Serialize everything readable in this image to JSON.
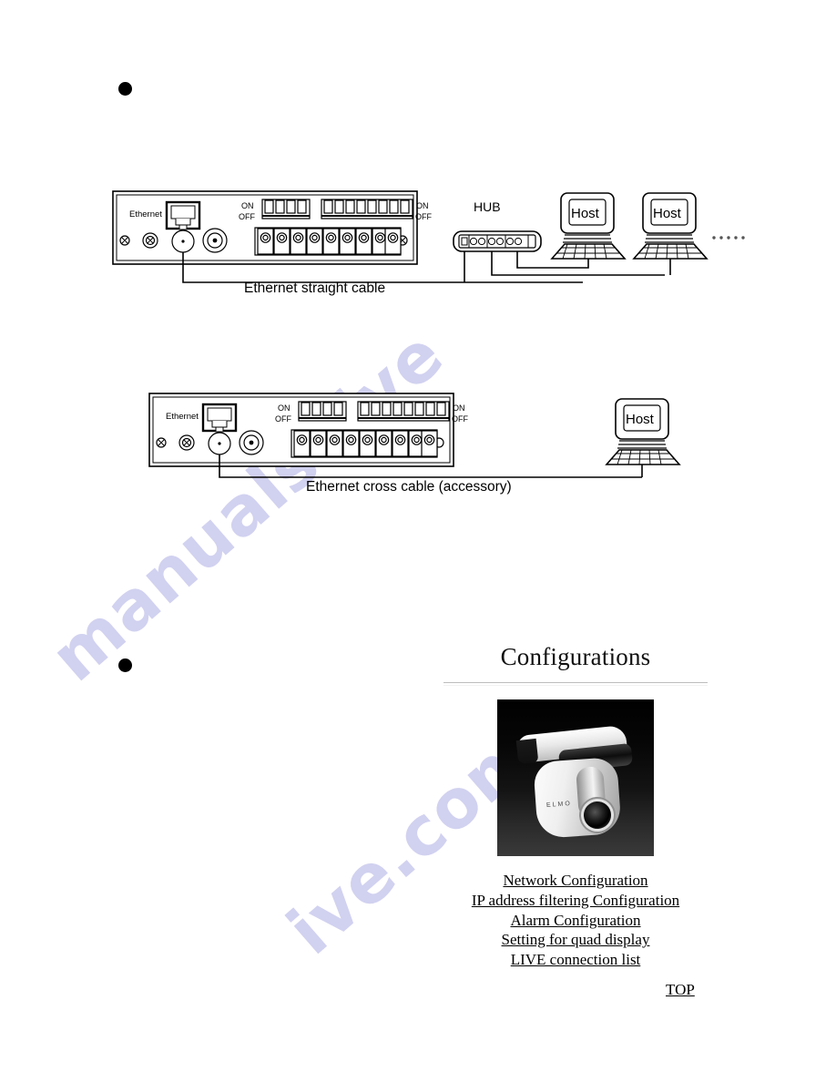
{
  "watermark": {
    "line1": "manualshive",
    "line2": "ive.com"
  },
  "bullets": [
    {
      "name": "bullet-marker-1"
    },
    {
      "name": "bullet-marker-2"
    }
  ],
  "figures": [
    {
      "id": "figure-1",
      "caption": "Ethernet straight cable",
      "device": {
        "port_label": "Ethernet",
        "dip_on_label": "ON",
        "dip_off_label": "OFF",
        "dip_left_positions": 4,
        "dip_right_positions": 8,
        "terminal_positions": 9
      },
      "network": {
        "hub_label": "HUB",
        "hub_ports": 6,
        "hosts": [
          "Host",
          "Host"
        ],
        "continuation": "· · · · ·"
      }
    },
    {
      "id": "figure-2",
      "caption": "Ethernet cross cable (accessory)",
      "device": {
        "port_label": "Ethernet",
        "dip_on_label": "ON",
        "dip_off_label": "OFF",
        "dip_left_positions": 4,
        "dip_right_positions": 8,
        "terminal_positions": 9
      },
      "network": {
        "hosts": [
          "Host"
        ]
      }
    }
  ],
  "configurations": {
    "title": "Configurations",
    "image_alt": "PTZ dome camera",
    "camera_brand": "ELMO",
    "links": [
      "Network Configuration",
      "IP address filtering Configuration",
      "Alarm Configuration",
      "Setting for quad display",
      "LIVE connection list"
    ]
  },
  "top_link": "TOP"
}
